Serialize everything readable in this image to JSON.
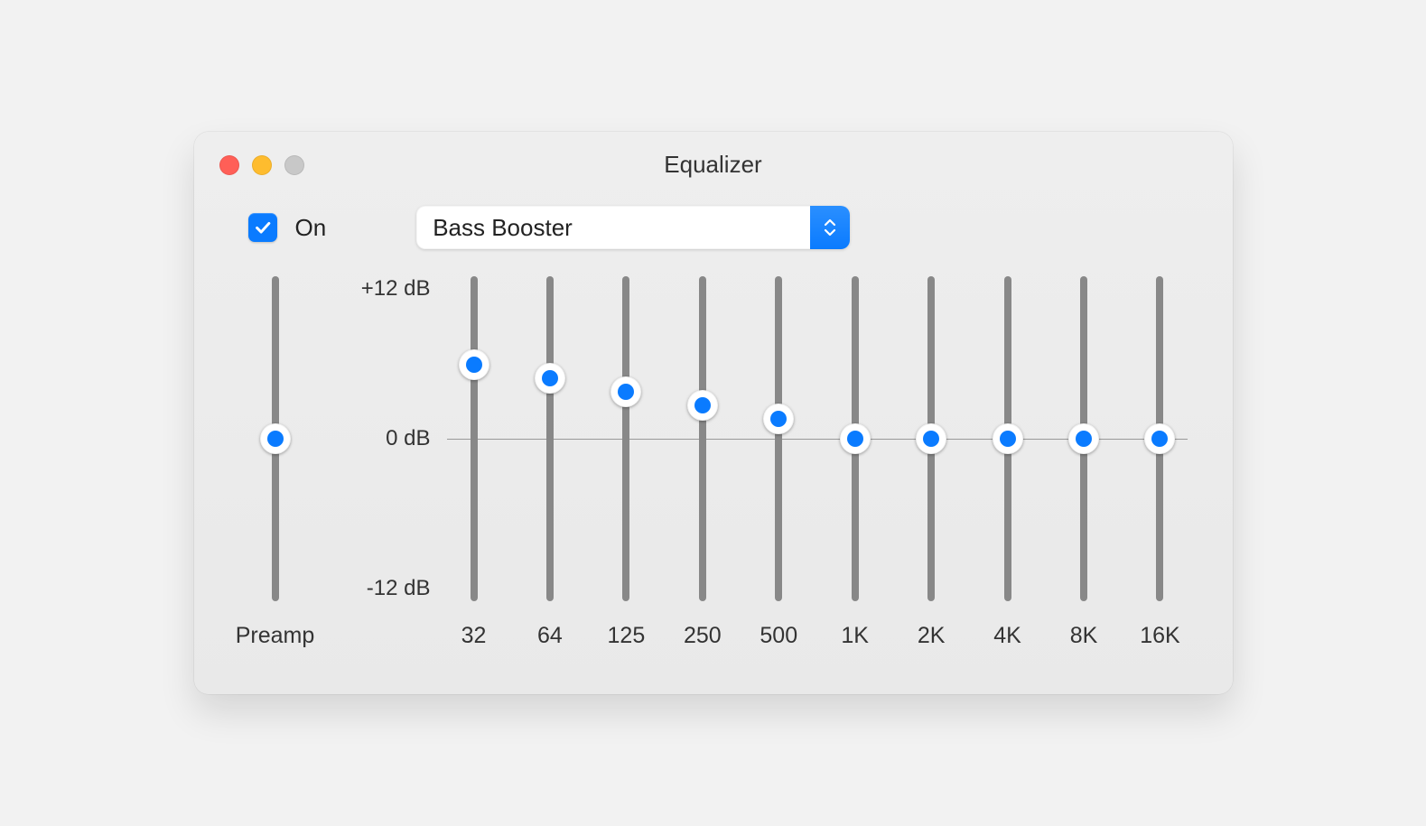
{
  "window": {
    "title": "Equalizer"
  },
  "toggle": {
    "on_label": "On",
    "checked": true
  },
  "preset": {
    "selected": "Bass Booster"
  },
  "db_labels": {
    "max": "+12 dB",
    "mid": "0 dB",
    "min": "-12 dB"
  },
  "preamp": {
    "label": "Preamp",
    "value_db": 0
  },
  "range_db": {
    "min": -12,
    "max": 12
  },
  "bands": [
    {
      "freq": "32",
      "value_db": 5.5
    },
    {
      "freq": "64",
      "value_db": 4.5
    },
    {
      "freq": "125",
      "value_db": 3.5
    },
    {
      "freq": "250",
      "value_db": 2.5
    },
    {
      "freq": "500",
      "value_db": 1.5
    },
    {
      "freq": "1K",
      "value_db": 0
    },
    {
      "freq": "2K",
      "value_db": 0
    },
    {
      "freq": "4K",
      "value_db": 0
    },
    {
      "freq": "8K",
      "value_db": 0
    },
    {
      "freq": "16K",
      "value_db": 0
    }
  ],
  "chart_data": {
    "type": "bar",
    "title": "Equalizer",
    "categories": [
      "Preamp",
      "32",
      "64",
      "125",
      "250",
      "500",
      "1K",
      "2K",
      "4K",
      "8K",
      "16K"
    ],
    "values": [
      0,
      5.5,
      4.5,
      3.5,
      2.5,
      1.5,
      0,
      0,
      0,
      0,
      0
    ],
    "ylabel": "dB",
    "ylim": [
      -12,
      12
    ]
  }
}
